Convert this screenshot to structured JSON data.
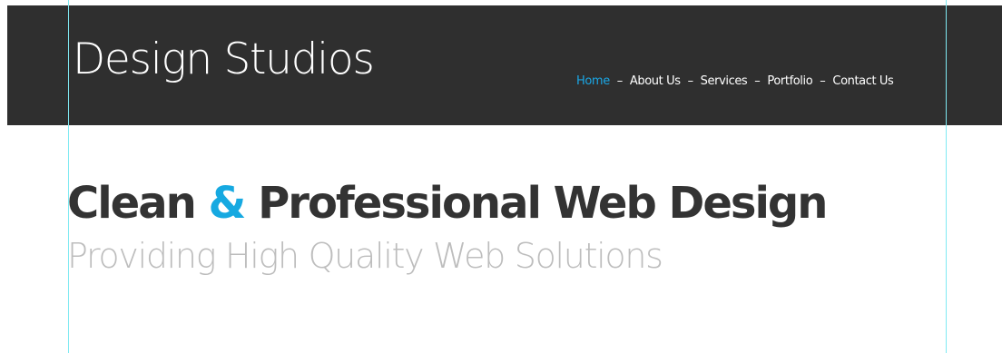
{
  "header": {
    "logo": "Design Studios",
    "nav": [
      {
        "label": "Home",
        "active": true
      },
      {
        "label": "About Us",
        "active": false
      },
      {
        "label": "Services",
        "active": false
      },
      {
        "label": "Portfolio",
        "active": false
      },
      {
        "label": "Contact Us",
        "active": false
      }
    ],
    "nav_separator": "–"
  },
  "hero": {
    "heading_part1": "Clean ",
    "heading_amp": "&",
    "heading_part2": " Professional Web Design",
    "subheading": "Providing High Quality Web Solutions"
  },
  "colors": {
    "header_bg": "#2f2f2f",
    "accent": "#16a9e1",
    "heading_text": "#333333",
    "subheading_text": "#bdbdbd",
    "guide_line": "#7fe9f2"
  }
}
